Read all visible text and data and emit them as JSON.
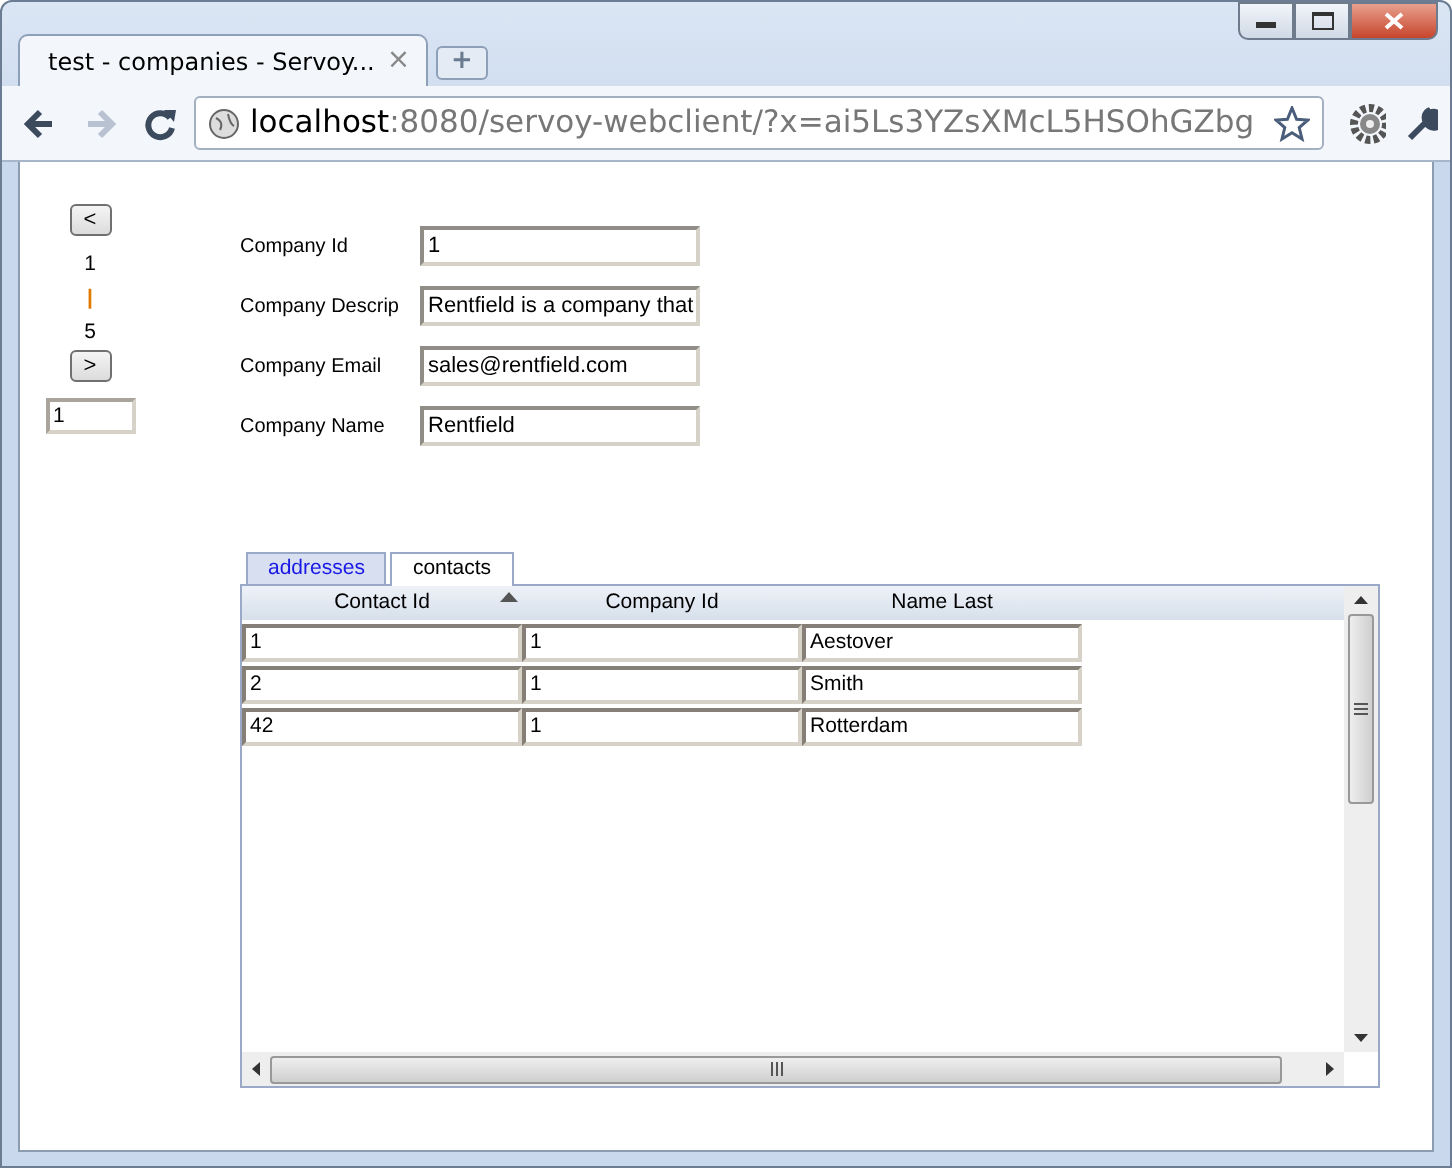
{
  "browser": {
    "tab_title": "test - companies - Servoy...",
    "tab_close": "×",
    "new_tab": "+",
    "nav_buttons": [
      {
        "kind": "back",
        "disabled": false
      },
      {
        "kind": "forward",
        "disabled": true
      },
      {
        "kind": "reload",
        "disabled": false
      }
    ],
    "url_host": "localhost",
    "url_rest": ":8080/servoy-webclient/?x=ai5Ls3YZsXMcL5HSOhGZbg"
  },
  "navigator": {
    "prev": "<",
    "current": "1",
    "separator": "|",
    "total": "5",
    "next": ">",
    "record_field": "1"
  },
  "fields": [
    {
      "label": "Company Id",
      "value": "1"
    },
    {
      "label": "Company Descrip",
      "value": "Rentfield is a company that"
    },
    {
      "label": "Company Email",
      "value": "sales@rentfield.com"
    },
    {
      "label": "Company Name",
      "value": "Rentfield"
    }
  ],
  "tabs": [
    {
      "label": "addresses",
      "selected": false
    },
    {
      "label": "contacts",
      "selected": true
    }
  ],
  "table": {
    "columns": [
      {
        "label": "Contact Id",
        "sorted": true
      },
      {
        "label": "Company Id",
        "sorted": false
      },
      {
        "label": "Name Last",
        "sorted": false
      }
    ],
    "rows": [
      [
        "1",
        "1",
        "Aestover"
      ],
      [
        "2",
        "1",
        "Smith"
      ],
      [
        "42",
        "1",
        "Rotterdam"
      ]
    ]
  }
}
